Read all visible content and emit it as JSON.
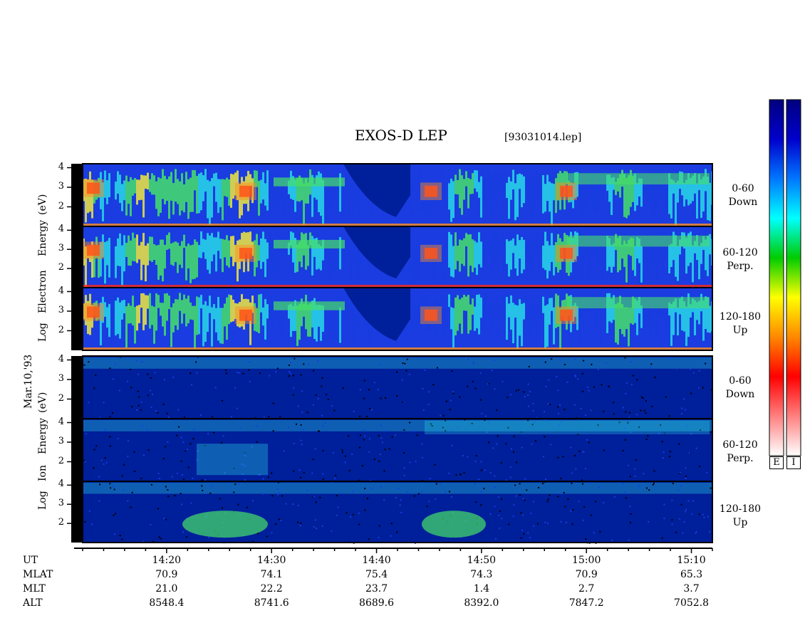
{
  "title": "EXOS-D LEP",
  "file_label": "[93031014.lep]",
  "date_label": "Mar.10,'93",
  "colorbar": {
    "labels": [
      "E",
      "I"
    ],
    "colors": [
      "#ffffff",
      "#ff8080",
      "#ff0000",
      "#ff8800",
      "#ffff00",
      "#00cc00",
      "#00ffff",
      "#0077ff",
      "#0000cc",
      "#000080"
    ]
  },
  "colors": {
    "blue_deep": "#001f9a",
    "blue_mid": "#1a3ce0",
    "cyan": "#28d8e6",
    "green": "#46e068",
    "yellow": "#f0e63c",
    "orange": "#ff8c1e",
    "red": "#ff2814",
    "black": "#000000"
  },
  "chart_data": [
    {
      "type": "heatmap",
      "group": "Electron",
      "ylabel_lines": [
        "Log",
        "Electron",
        "Energy",
        "(eV)"
      ],
      "ylim": [
        1,
        4.2
      ],
      "yticks": [
        "4",
        "3",
        "2"
      ],
      "panels": [
        {
          "name": "0-60 Down",
          "label_lines": [
            "0-60",
            "Down"
          ]
        },
        {
          "name": "60-120 Perp.",
          "label_lines": [
            "60-120",
            "Perp."
          ]
        },
        {
          "name": "120-180 Up",
          "label_lines": [
            "120-180",
            "Up"
          ]
        }
      ],
      "x_time_range": [
        "14:12",
        "15:12"
      ]
    },
    {
      "type": "heatmap",
      "group": "Ion",
      "ylabel_lines": [
        "Log",
        "Ion",
        "Energy",
        "(eV)"
      ],
      "ylim": [
        1,
        4.2
      ],
      "yticks": [
        "4",
        "3",
        "2"
      ],
      "panels": [
        {
          "name": "0-60 Down",
          "label_lines": [
            "0-60",
            "Down"
          ]
        },
        {
          "name": "60-120 Perp.",
          "label_lines": [
            "60-120",
            "Perp."
          ]
        },
        {
          "name": "120-180 Up",
          "label_lines": [
            "120-180",
            "Up"
          ]
        }
      ],
      "x_time_range": [
        "14:12",
        "15:12"
      ]
    }
  ],
  "ephemeris": {
    "row_labels": [
      "UT",
      "MLAT",
      "MLT",
      "ALT"
    ],
    "columns": [
      {
        "UT": "14:20",
        "MLAT": "70.9",
        "MLT": "21.0",
        "ALT": "8548.4"
      },
      {
        "UT": "14:30",
        "MLAT": "74.1",
        "MLT": "22.2",
        "ALT": "8741.6"
      },
      {
        "UT": "14:40",
        "MLAT": "75.4",
        "MLT": "23.7",
        "ALT": "8689.6"
      },
      {
        "UT": "14:50",
        "MLAT": "74.3",
        "MLT": "1.4",
        "ALT": "8392.0"
      },
      {
        "UT": "15:00",
        "MLAT": "70.9",
        "MLT": "2.7",
        "ALT": "7847.2"
      },
      {
        "UT": "15:10",
        "MLAT": "65.3",
        "MLT": "3.7",
        "ALT": "7052.8"
      }
    ]
  }
}
